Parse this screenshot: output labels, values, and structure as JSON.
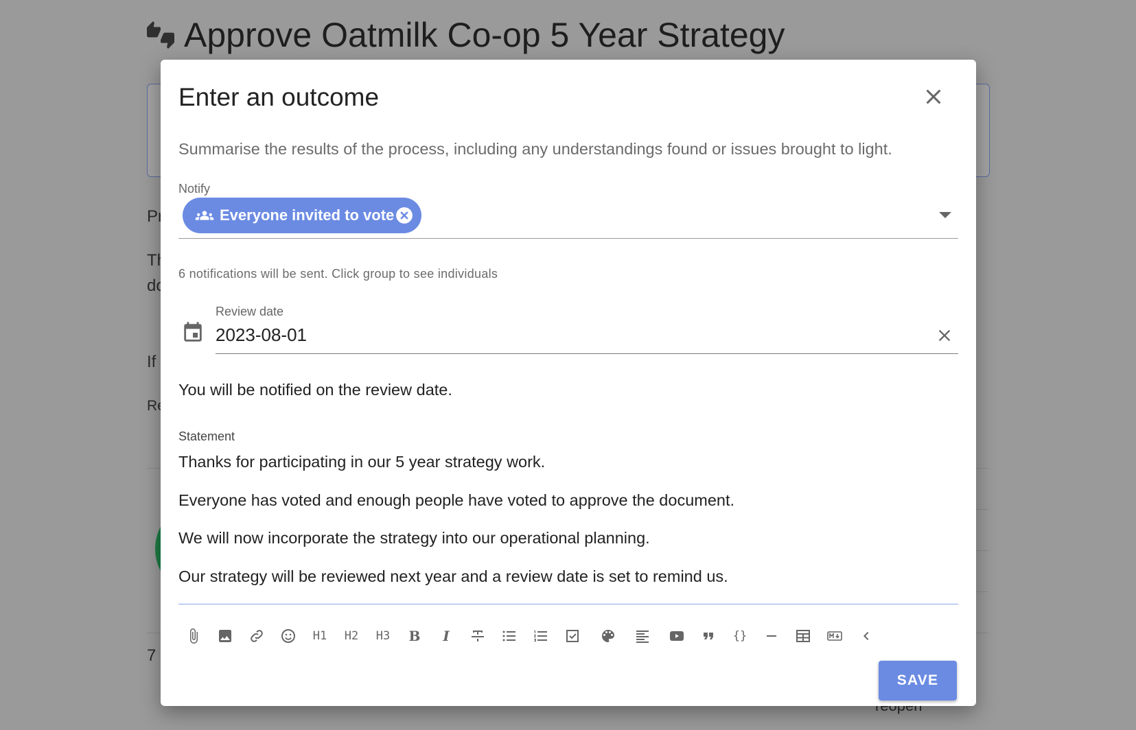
{
  "background": {
    "poll_title": "Approve Oatmilk Co-op 5 Year Strategy",
    "poll_icon": "thumbs-up-down-icon",
    "fragments": [
      "Pr",
      "Th",
      "do",
      "If",
      "Re",
      "7"
    ],
    "reopen_label": "reopen"
  },
  "modal": {
    "title": "Enter an outcome",
    "close_icon": "close-icon",
    "helper_text": "Summarise the results of the process, including any understandings found or issues brought to light.",
    "notify": {
      "label": "Notify",
      "chip_label": "Everyone invited to vote",
      "chip_icon": "group-icon",
      "notification_count_text": "6 notifications will be sent. Click group to see individuals"
    },
    "review_date": {
      "label": "Review date",
      "value": "2023-08-01",
      "icon": "calendar-icon"
    },
    "review_notice": "You will be notified on the review date.",
    "statement": {
      "label": "Statement",
      "paragraphs": [
        "Thanks for participating in our 5 year strategy work.",
        "Everyone has voted and enough people have voted to approve the document.",
        "We will now incorporate the strategy into our operational planning.",
        "Our strategy will be reviewed next year and a review date is set to remind us."
      ]
    },
    "toolbar": {
      "h1": "H1",
      "h2": "H2",
      "h3": "H3",
      "bold": "B",
      "italic": "I",
      "code": "{}"
    },
    "save_label": "SAVE"
  },
  "colors": {
    "accent": "#6b8be3",
    "overlay": "#9a9a9a"
  }
}
